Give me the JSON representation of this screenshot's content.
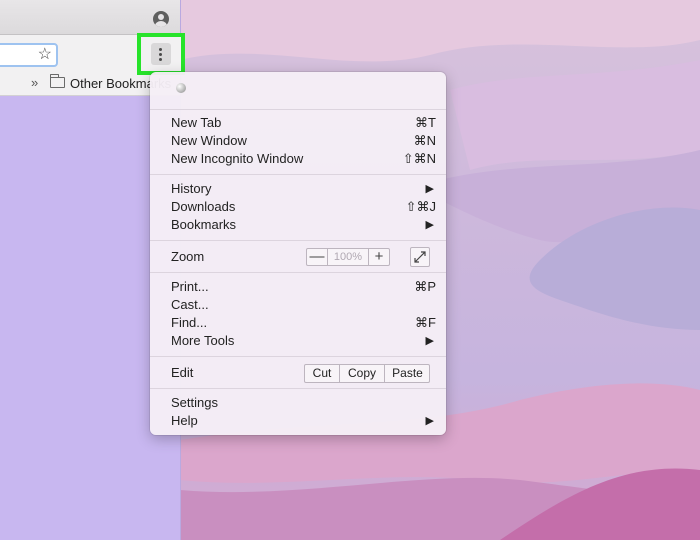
{
  "browser": {
    "bookmarks_bar": {
      "overflow_glyph": "»",
      "folder_label": "Other Bookmarks"
    }
  },
  "menu": {
    "sections": {
      "new": [
        {
          "label": "New Tab",
          "shortcut": "⌘T"
        },
        {
          "label": "New Window",
          "shortcut": "⌘N"
        },
        {
          "label": "New Incognito Window",
          "shortcut": "⇧⌘N"
        }
      ],
      "history": [
        {
          "label": "History"
        },
        {
          "label": "Downloads",
          "shortcut": "⇧⌘J"
        },
        {
          "label": "Bookmarks"
        }
      ],
      "zoom": {
        "label": "Zoom",
        "minus": "—",
        "value": "100%",
        "plus": "+"
      },
      "tools": [
        {
          "label": "Print...",
          "shortcut": "⌘P"
        },
        {
          "label": "Cast..."
        },
        {
          "label": "Find...",
          "shortcut": "⌘F"
        },
        {
          "label": "More Tools"
        }
      ],
      "edit": {
        "label": "Edit",
        "cut": "Cut",
        "copy": "Copy",
        "paste": "Paste"
      },
      "settings": [
        {
          "label": "Settings"
        },
        {
          "label": "Help"
        }
      ]
    },
    "submenu_arrow": "▶"
  },
  "icons": {
    "star": "☆",
    "menu_button_highlight": "#27e32a"
  }
}
